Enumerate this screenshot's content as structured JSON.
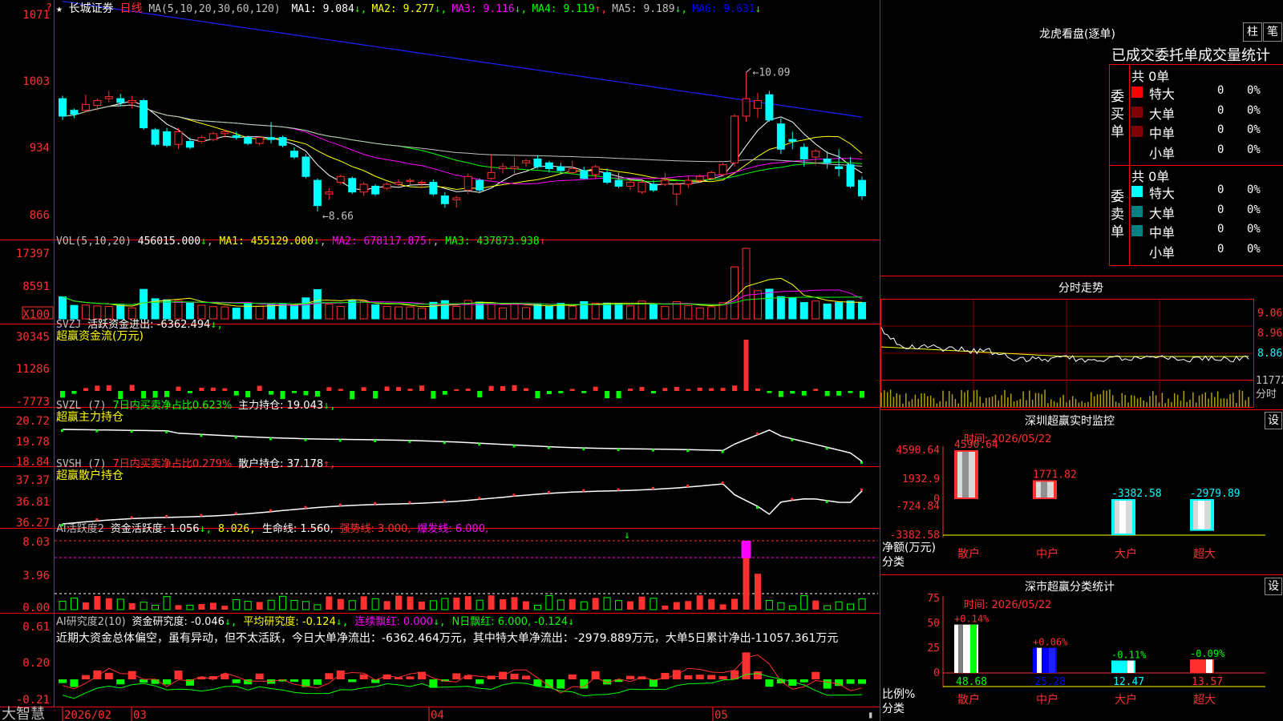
{
  "app": {
    "brand": "大智慧"
  },
  "main": {
    "star": "★",
    "stock": "长城证券",
    "period": "日线",
    "ma_legend": {
      "params": "MA(5,10,20,30,60,120)",
      "items": [
        {
          "label": "MA1:",
          "value": "9.084",
          "arrow": "↓",
          "color": "#ffffff"
        },
        {
          "label": "MA2:",
          "value": "9.277",
          "arrow": "↓",
          "color": "#ffff00"
        },
        {
          "label": "MA3:",
          "value": "9.116",
          "arrow": "↓",
          "color": "#ff00ff"
        },
        {
          "label": "MA4:",
          "value": "9.119",
          "arrow": "↑",
          "color": "#00ff00"
        },
        {
          "label": "MA5:",
          "value": "9.189",
          "arrow": "↓",
          "color": "#c0c0c0"
        },
        {
          "label": "MA6:",
          "value": "9.631",
          "arrow": "↓",
          "color": "#0000ff"
        }
      ]
    },
    "y_ticks": [
      "1071",
      "1003",
      "934",
      "866"
    ],
    "high_label": "10.09",
    "low_label": "8.66",
    "dates": [
      "2026/02",
      "03",
      "04",
      "05"
    ]
  },
  "vol": {
    "title": "VOL(5,10,20)",
    "value": "456015.000",
    "value_arrow": "↓",
    "ma1": "MA1: 455129.000",
    "ma1_arrow": "↓",
    "ma2": "MA2: 678117.875",
    "ma2_arrow": "↑",
    "ma3": "MA3: 437873.938",
    "ma3_arrow": "↑",
    "y_ticks": [
      "17397",
      "8591",
      "X100"
    ]
  },
  "svzj": {
    "title": "SVZJ",
    "label": "活跃资金进出: -6362.494",
    "arrow": "↓,",
    "sub": "超赢资金流(万元)",
    "y_ticks": [
      "30345",
      "11286",
      "-7773"
    ]
  },
  "svzl": {
    "title": "SVZL (7)",
    "red_text": "7日内买卖净占比0.623%",
    "label": "主力持仓: 19.043",
    "arrow": "↓,",
    "sub": "超赢主力持仓",
    "y_ticks": [
      "20.72",
      "19.78",
      "18.84"
    ]
  },
  "svsh": {
    "title": "SVSH (7)",
    "red_text": "7日内买卖净占比0.279%",
    "label": "散户持仓: 37.178",
    "arrow": "↑,",
    "sub": "超赢散户持仓",
    "y_ticks": [
      "37.37",
      "36.81",
      "36.27"
    ]
  },
  "ai1": {
    "title": "AI活跃度2",
    "label": "资金活跃度: 1.056",
    "arrow": "↓,",
    "v2": "8.026,",
    "life": "生命线: 1.560,",
    "strong": "强势线: 3.000,",
    "burst": "爆发线: 6.000,",
    "y_ticks": [
      "8.03",
      "3.96",
      "0.00"
    ]
  },
  "ai2": {
    "title": "AI研究度2(10)",
    "label": "资金研究度: -0.046",
    "arrow": "↓,",
    "avg": "平均研究度: -0.124",
    "avg_arrow": "↓,",
    "lianxu": "连续飘红: 0.000",
    "lianxu_arrow": "↓,",
    "n": "N日飘红: 6.000, -0.124",
    "n_arrow": "↓",
    "comment": "近期大资金总体偏空，虽有异动，但不太活跃，今日大单净流出：-6362.464万元，其中特大单净流出：-2979.889万元，大单5日累计净出-11057.361万元",
    "y_ticks": [
      "0.61",
      "0.20",
      "-0.21"
    ]
  },
  "right": {
    "lhb_title": "龙虎看盘(逐单)",
    "btn_zhu": "柱",
    "btn_bi": "笔",
    "stats_title": "已成交委托单成交量统计",
    "buy": {
      "side": "委买单",
      "total": "共 0单",
      "rows": [
        {
          "name": "特大",
          "count": "0",
          "pct": "0%",
          "color": "#ff0000"
        },
        {
          "name": "大单",
          "count": "0",
          "pct": "0%",
          "color": "#800000"
        },
        {
          "name": "中单",
          "count": "0",
          "pct": "0%",
          "color": "#800000"
        },
        {
          "name": "小单",
          "count": "0",
          "pct": "0%",
          "color": "#000000"
        }
      ]
    },
    "sell": {
      "side": "委卖单",
      "total": "共 0单",
      "rows": [
        {
          "name": "特大",
          "count": "0",
          "pct": "0%",
          "color": "#00ffff"
        },
        {
          "name": "大单",
          "count": "0",
          "pct": "0%",
          "color": "#008080"
        },
        {
          "name": "中单",
          "count": "0",
          "pct": "0%",
          "color": "#008080"
        },
        {
          "name": "小单",
          "count": "0",
          "pct": "0%",
          "color": "#000000"
        }
      ]
    },
    "intraday": {
      "title": "分时走势",
      "ticks": [
        "9.06",
        "8.96",
        "8.86",
        "11772",
        "分时"
      ]
    },
    "monitor": {
      "title": "深圳超赢实时监控",
      "btn": "设",
      "time": "时间: 2026/05/22",
      "y_ticks": [
        "4590.64",
        "1932.9",
        "0",
        "-724.84",
        "-3382.58"
      ],
      "ylabel": "净额(万元)",
      "xlabel": "分类",
      "bars": [
        {
          "cat": "散户",
          "label": "4590.64",
          "value": 4590.64
        },
        {
          "cat": "中户",
          "label": "1771.82",
          "value": 1771.82
        },
        {
          "cat": "大户",
          "label": "-3382.58",
          "value": -3382.58
        },
        {
          "cat": "超大",
          "label": "-2979.89",
          "value": -2979.89
        }
      ]
    },
    "classify": {
      "title": "深市超赢分类统计",
      "btn": "设",
      "time": "时间: 2026/05/22",
      "y_ticks": [
        "75",
        "50",
        "25",
        "0"
      ],
      "ylabel": "比例%",
      "xlabel": "分类",
      "bars": [
        {
          "cat": "散户",
          "value": 48.68,
          "label": "48.68",
          "chg": "+0.14%"
        },
        {
          "cat": "中户",
          "value": 25.28,
          "label": "25.28",
          "chg": "+0.06%"
        },
        {
          "cat": "大户",
          "value": 12.47,
          "label": "12.47",
          "chg": "-0.11%"
        },
        {
          "cat": "超大",
          "value": 13.57,
          "label": "13.57",
          "chg": "-0.09%"
        }
      ]
    }
  },
  "chart_data": [
    {
      "type": "candlestick",
      "title": "长城证券 日线",
      "y_axis_ticks": [
        10.71,
        10.03,
        9.34,
        8.66
      ],
      "ylim": [
        8.55,
        10.75
      ],
      "marked_high": 10.09,
      "marked_low": 8.66,
      "x_ticks": [
        "2026/02",
        "03",
        "04",
        "05"
      ],
      "ohlc": [
        [
          9.82,
          9.85,
          9.6,
          9.64
        ],
        [
          9.7,
          9.72,
          9.62,
          9.66
        ],
        [
          9.7,
          9.86,
          9.68,
          9.76
        ],
        [
          9.75,
          9.82,
          9.7,
          9.8
        ],
        [
          9.82,
          9.9,
          9.78,
          9.84
        ],
        [
          9.82,
          9.87,
          9.74,
          9.78
        ],
        [
          9.78,
          9.85,
          9.72,
          9.8
        ],
        [
          9.8,
          9.82,
          9.5,
          9.52
        ],
        [
          9.5,
          9.52,
          9.33,
          9.35
        ],
        [
          9.48,
          9.52,
          9.32,
          9.34
        ],
        [
          9.35,
          9.52,
          9.3,
          9.48
        ],
        [
          9.38,
          9.42,
          9.3,
          9.32
        ],
        [
          9.38,
          9.44,
          9.36,
          9.42
        ],
        [
          9.4,
          9.48,
          9.38,
          9.46
        ],
        [
          9.46,
          9.5,
          9.42,
          9.48
        ],
        [
          9.44,
          9.48,
          9.4,
          9.42
        ],
        [
          9.42,
          9.44,
          9.34,
          9.36
        ],
        [
          9.36,
          9.44,
          9.34,
          9.42
        ],
        [
          9.42,
          9.58,
          9.36,
          9.4
        ],
        [
          9.42,
          9.44,
          9.32,
          9.34
        ],
        [
          9.28,
          9.32,
          9.2,
          9.22
        ],
        [
          9.22,
          9.25,
          9.0,
          9.02
        ],
        [
          8.98,
          9.0,
          8.66,
          8.72
        ],
        [
          8.84,
          8.9,
          8.78,
          8.86
        ],
        [
          8.96,
          9.04,
          8.94,
          9.02
        ],
        [
          9.0,
          9.02,
          8.84,
          8.86
        ],
        [
          8.86,
          8.96,
          8.82,
          8.94
        ],
        [
          8.92,
          8.94,
          8.82,
          8.84
        ],
        [
          8.9,
          8.96,
          8.88,
          8.94
        ],
        [
          8.94,
          8.99,
          8.92,
          8.96
        ],
        [
          8.97,
          9.0,
          8.94,
          8.98
        ],
        [
          8.95,
          8.98,
          8.9,
          8.96
        ],
        [
          8.96,
          8.99,
          8.82,
          8.84
        ],
        [
          8.82,
          8.86,
          8.7,
          8.74
        ],
        [
          8.78,
          8.82,
          8.7,
          8.8
        ],
        [
          8.88,
          9.05,
          8.84,
          9.02
        ],
        [
          8.98,
          9.0,
          8.86,
          8.88
        ],
        [
          9.0,
          9.24,
          8.98,
          9.06
        ],
        [
          9.1,
          9.16,
          9.05,
          9.12
        ],
        [
          9.1,
          9.22,
          9.05,
          9.12
        ],
        [
          9.16,
          9.2,
          9.12,
          9.18
        ],
        [
          9.2,
          9.24,
          9.1,
          9.12
        ],
        [
          9.16,
          9.18,
          9.06,
          9.1
        ],
        [
          9.12,
          9.16,
          9.04,
          9.08
        ],
        [
          9.06,
          9.18,
          9.04,
          9.1
        ],
        [
          9.08,
          9.12,
          8.99,
          9.0
        ],
        [
          9.04,
          9.14,
          9.0,
          9.12
        ],
        [
          9.06,
          9.1,
          8.94,
          8.96
        ],
        [
          8.98,
          9.06,
          8.9,
          8.92
        ],
        [
          8.92,
          8.99,
          8.88,
          8.96
        ],
        [
          8.86,
          8.98,
          8.84,
          8.96
        ],
        [
          8.94,
          8.98,
          8.86,
          8.88
        ],
        [
          8.94,
          9.06,
          8.92,
          8.98
        ],
        [
          8.84,
          8.96,
          8.72,
          8.94
        ],
        [
          8.94,
          9.02,
          8.9,
          8.98
        ],
        [
          8.98,
          9.04,
          8.96,
          9.02
        ],
        [
          9.0,
          9.08,
          8.98,
          9.06
        ],
        [
          9.04,
          9.16,
          9.02,
          9.14
        ],
        [
          9.16,
          9.66,
          9.12,
          9.64
        ],
        [
          9.64,
          10.09,
          9.58,
          9.82
        ],
        [
          9.72,
          9.88,
          9.62,
          9.8
        ],
        [
          9.86,
          9.9,
          9.58,
          9.6
        ],
        [
          9.56,
          9.62,
          9.25,
          9.3
        ],
        [
          9.4,
          9.48,
          9.3,
          9.38
        ],
        [
          9.32,
          9.36,
          9.12,
          9.2
        ],
        [
          9.22,
          9.3,
          9.14,
          9.28
        ],
        [
          9.2,
          9.28,
          9.1,
          9.16
        ],
        [
          9.12,
          9.3,
          9.02,
          9.1
        ],
        [
          9.14,
          9.22,
          8.9,
          8.92
        ],
        [
          8.98,
          9.02,
          8.78,
          8.82
        ]
      ]
    },
    {
      "type": "bar",
      "title": "VOL(5,10,20)",
      "y_axis_ticks": [
        17397,
        8591
      ],
      "unit": "X100",
      "series": [
        {
          "name": "VOL",
          "values": [
            456015.0
          ]
        },
        {
          "name": "MA1",
          "values": [
            455129.0
          ]
        },
        {
          "name": "MA2",
          "values": [
            678117.875
          ]
        },
        {
          "name": "MA3",
          "values": [
            437873.938
          ]
        }
      ]
    },
    {
      "type": "bar",
      "title": "SVZJ 超赢资金流(万元)",
      "y_axis_ticks": [
        30345,
        11286,
        -7773
      ],
      "series": [
        {
          "name": "活跃资金进出",
          "values": [
            -6362.494
          ]
        }
      ]
    },
    {
      "type": "line",
      "title": "SVZL 超赢主力持仓",
      "y_axis_ticks": [
        20.72,
        19.78,
        18.84
      ],
      "series": [
        {
          "name": "主力持仓",
          "values": [
            19.043
          ]
        }
      ]
    },
    {
      "type": "line",
      "title": "SVSH 超赢散户持仓",
      "y_axis_ticks": [
        37.37,
        36.81,
        36.27
      ],
      "series": [
        {
          "name": "散户持仓",
          "values": [
            37.178
          ]
        }
      ]
    },
    {
      "type": "bar",
      "title": "AI活跃度2",
      "y_axis_ticks": [
        8.03,
        3.96,
        0.0
      ],
      "series": [
        {
          "name": "资金活跃度",
          "values": [
            1.056
          ]
        }
      ]
    },
    {
      "type": "bar",
      "title": "AI研究度2(10)",
      "y_axis_ticks": [
        0.61,
        0.2,
        -0.21
      ],
      "series": [
        {
          "name": "资金研究度",
          "values": [
            -0.046
          ]
        },
        {
          "name": "平均研究度",
          "values": [
            -0.124
          ]
        }
      ]
    },
    {
      "type": "bar",
      "title": "深圳超赢实时监控",
      "xlabel": "分类",
      "ylabel": "净额(万元)",
      "categories": [
        "散户",
        "中户",
        "大户",
        "超大"
      ],
      "values": [
        4590.64,
        1771.82,
        -3382.58,
        -2979.89
      ],
      "y_axis_ticks": [
        4590.64,
        1932.9,
        0,
        -724.84,
        -3382.58
      ]
    },
    {
      "type": "bar",
      "title": "深市超赢分类统计",
      "xlabel": "分类",
      "ylabel": "比例%",
      "categories": [
        "散户",
        "中户",
        "大户",
        "超大"
      ],
      "values": [
        48.68,
        25.28,
        12.47,
        13.57
      ],
      "changes": [
        "+0.14%",
        "+0.06%",
        "-0.11%",
        "-0.09%"
      ],
      "ylim": [
        0,
        75
      ]
    }
  ]
}
